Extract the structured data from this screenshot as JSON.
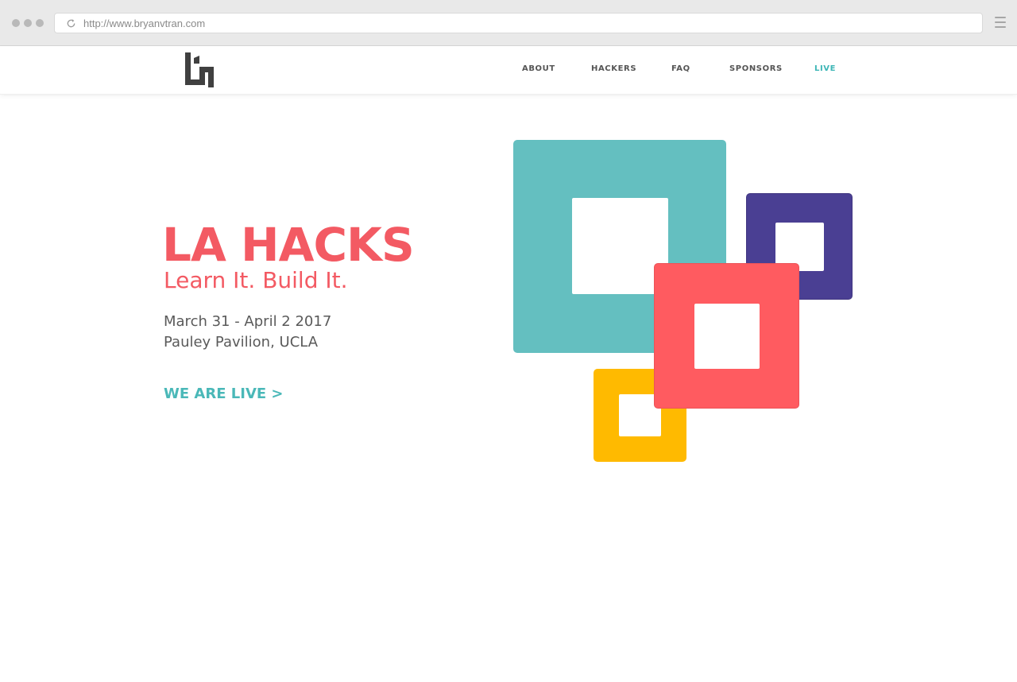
{
  "browser": {
    "url": "http://www.bryanvtran.com",
    "icons": {
      "window_controls": "traffic-light-dots",
      "reload": "reload-icon",
      "menu": "hamburger-menu-icon"
    }
  },
  "nav": {
    "logo_icon": "lh-logo",
    "links": [
      {
        "label": "ABOUT"
      },
      {
        "label": "HACKERS"
      },
      {
        "label": "FAQ"
      },
      {
        "label": "SPONSORS"
      },
      {
        "label": "LIVE",
        "active": true
      }
    ]
  },
  "hero": {
    "title": "LA HACKS",
    "tagline": "Learn It. Build It.",
    "date": "March 31 - April 2 2017",
    "venue": "Pauley Pavilion, UCLA",
    "cta": "WE ARE LIVE >"
  },
  "colors": {
    "accent_red": "#f35a63",
    "accent_teal": "#64bfc0",
    "accent_purple": "#4a3f93",
    "accent_yellow": "#ffba00",
    "cta_teal": "#4ab8b8",
    "logo_dark": "#404040"
  }
}
